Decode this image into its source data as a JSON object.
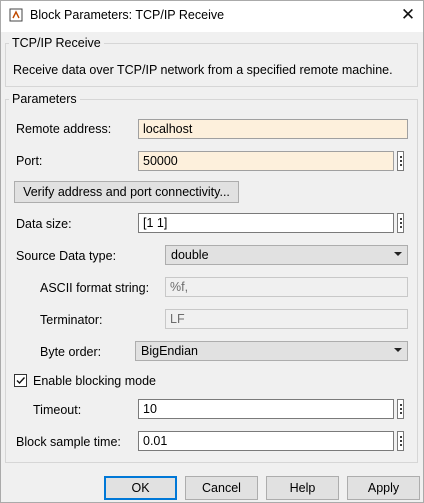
{
  "window": {
    "title": "Block Parameters: TCP/IP Receive"
  },
  "block": {
    "group_title": "TCP/IP Receive",
    "description": "Receive data over TCP/IP network from a specified remote machine."
  },
  "params": {
    "group_title": "Parameters",
    "remote_address": {
      "label": "Remote address:",
      "value": "localhost"
    },
    "port": {
      "label": "Port:",
      "value": "50000"
    },
    "verify_button": "Verify address and port connectivity...",
    "data_size": {
      "label": "Data size:",
      "value": "[1 1]"
    },
    "source_type": {
      "label": "Source Data type:",
      "value": "double"
    },
    "ascii_format": {
      "label": "ASCII format string:",
      "value": "%f,"
    },
    "terminator": {
      "label": "Terminator:",
      "value": "LF"
    },
    "byte_order": {
      "label": "Byte order:",
      "value": "BigEndian"
    },
    "blocking": {
      "label": "Enable blocking mode",
      "checked": true
    },
    "timeout": {
      "label": "Timeout:",
      "value": "10"
    },
    "sample_time": {
      "label": "Block sample time:",
      "value": "0.01"
    }
  },
  "buttons": {
    "ok": "OK",
    "cancel": "Cancel",
    "help": "Help",
    "apply": "Apply"
  },
  "colors": {
    "editable_field_bg": "#fdf0dc",
    "focus_blue": "#0078d7"
  }
}
